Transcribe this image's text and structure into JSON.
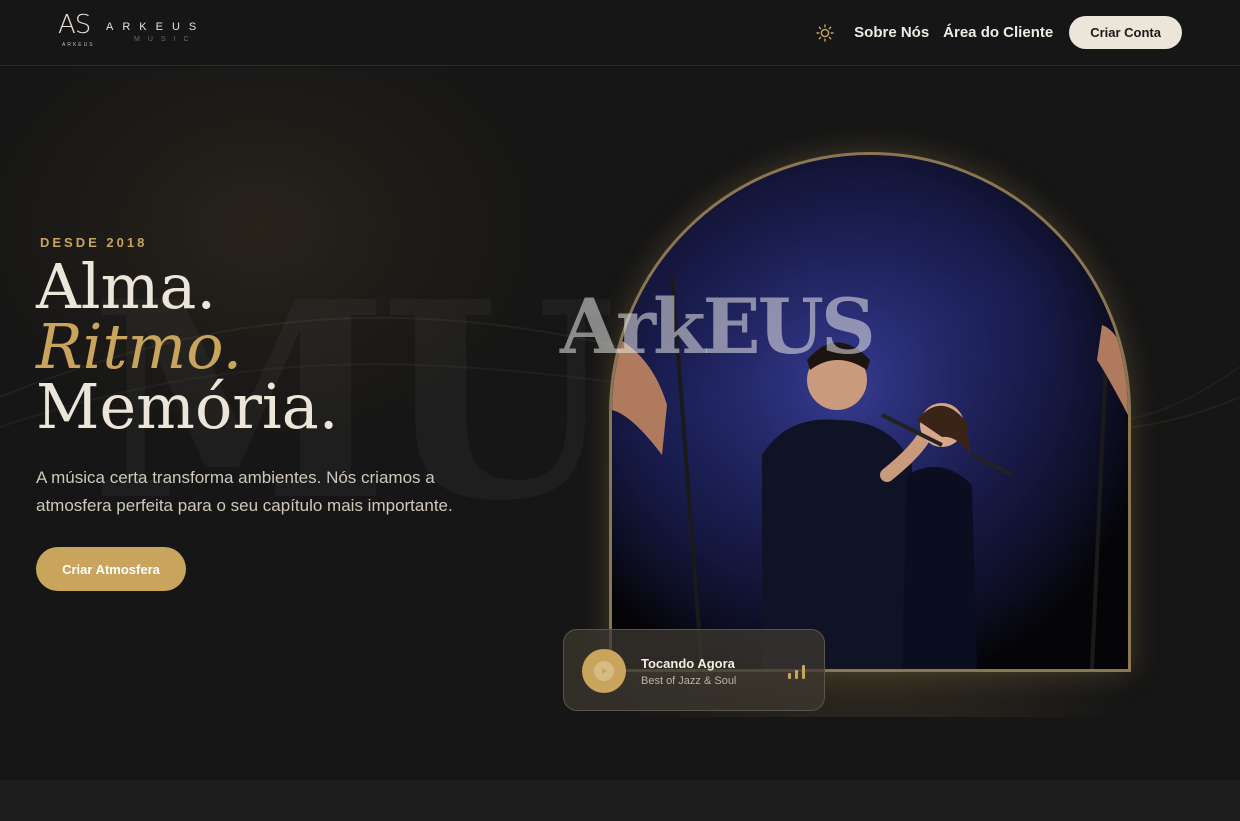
{
  "brand": {
    "monogram": "AS",
    "monogram_sub": "ARKEUS",
    "wordmark": "ARKEUS",
    "tagline": "MUSIC"
  },
  "nav": {
    "theme_icon": "sun-icon",
    "links": [
      "Sobre Nós",
      "Área do Cliente"
    ],
    "cta_label": "Criar Conta"
  },
  "hero": {
    "eyebrow": "DESDE 2018",
    "headline_1": "Alma.",
    "headline_2": "Ritmo.",
    "headline_3": "Memória.",
    "lead": "A música certa transforma ambientes. Nós criamos a atmosfera perfeita para o seu capítulo mais importante.",
    "cta_label": "Criar Atmosfera",
    "watermark": "MUS",
    "image_overlay_text": "ArkEUS"
  },
  "player": {
    "title": "Tocando Agora",
    "track": "Best of Jazz & Soul",
    "play_icon": "play-icon",
    "eq_icon": "equalizer-icon"
  },
  "colors": {
    "accent": "#c8a45c",
    "background": "#161616",
    "text": "#ece6da"
  }
}
